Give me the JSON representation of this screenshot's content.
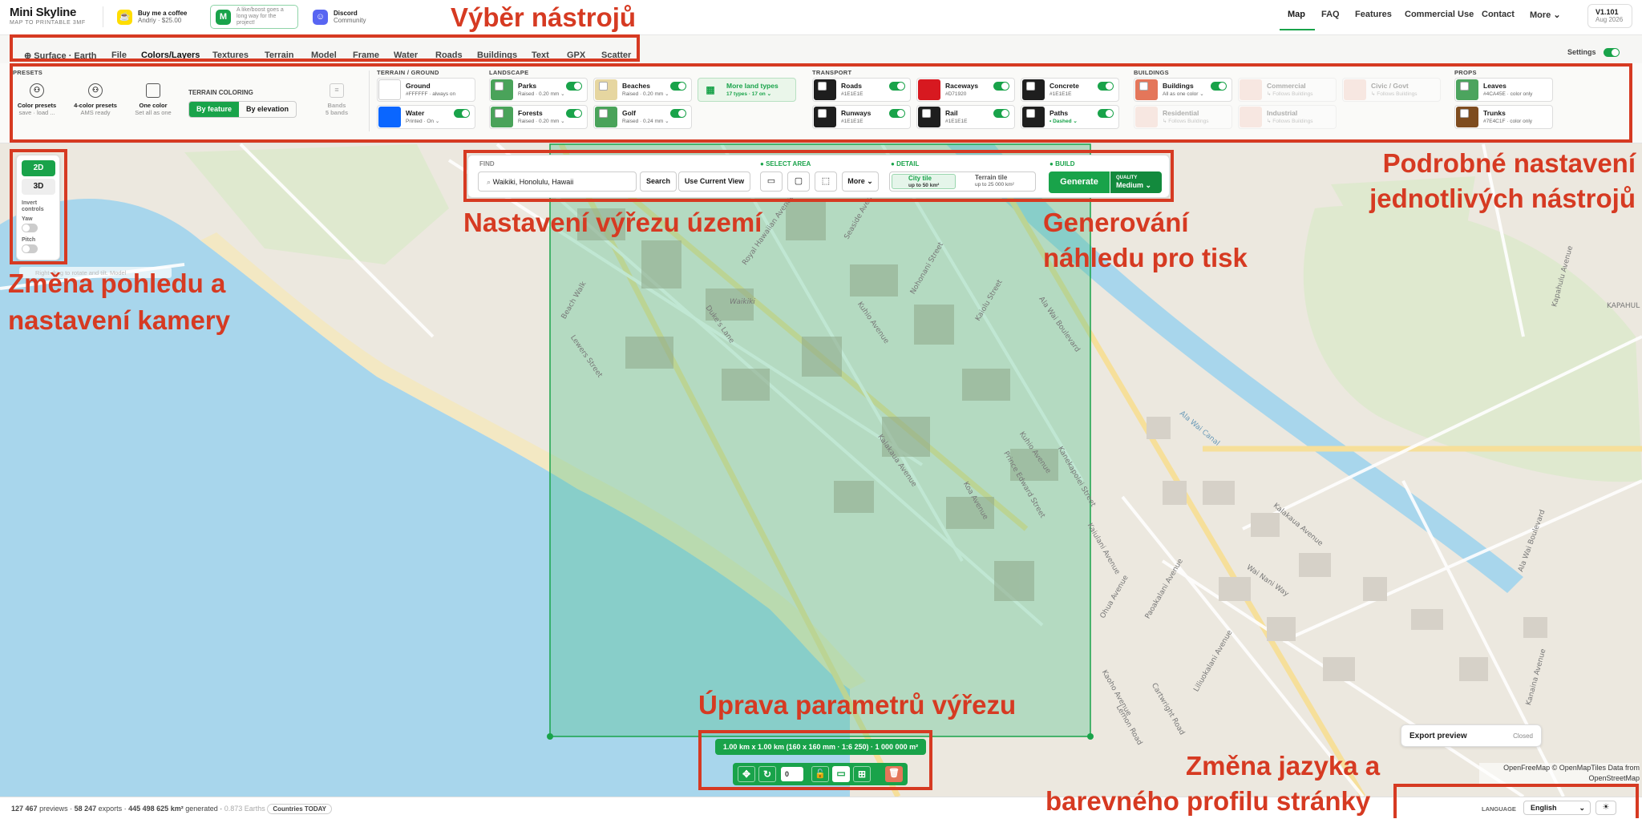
{
  "header": {
    "brand_title": "Mini Skyline",
    "brand_sub": "MAP TO PRINTABLE 3MF",
    "coffee": {
      "title": "Buy me a coffee",
      "sub": "Andriy · $25.00"
    },
    "like": {
      "line1": "A like/boost goes a",
      "line2": "long way for the",
      "line3": "project!"
    },
    "discord": {
      "title": "Discord",
      "sub": "Community"
    },
    "nav": [
      "Map",
      "FAQ",
      "Features",
      "Commercial Use",
      "Contact",
      "More"
    ],
    "version": "V1.101",
    "version_date": "Aug 2026"
  },
  "tabs": [
    "Surface · Earth",
    "File",
    "Colors/Layers",
    "Textures",
    "Terrain",
    "Model",
    "Frame",
    "Water",
    "Roads",
    "Buildings",
    "Text",
    "GPX",
    "Scatter"
  ],
  "settings_label": "Settings",
  "panel": {
    "presets_heading": "PRESETS",
    "presets": [
      {
        "title": "Color presets",
        "sub": "save · load ..."
      },
      {
        "title": "4-color presets",
        "sub": "AMS ready"
      },
      {
        "title": "One color",
        "sub": "Set all as one"
      }
    ],
    "terrain_coloring": "TERRAIN COLORING",
    "seg_by_feature": "By feature",
    "seg_by_elevation": "By elevation",
    "bands": "Bands",
    "bands_sub": "5 bands",
    "groups": [
      "TERRAIN / GROUND",
      "LANDSCAPE",
      "TRANSPORT",
      "BUILDINGS",
      "PROPS"
    ],
    "layers": [
      {
        "name": "Ground",
        "sub": "#FFFFFF · always on",
        "color": "#ffffff"
      },
      {
        "name": "Water",
        "sub": "Printed · On ⌄",
        "color": "#0a66ff"
      },
      {
        "name": "Parks",
        "sub": "Raised · 0.20 mm ⌄",
        "color": "#4aa35a"
      },
      {
        "name": "Forests",
        "sub": "Raised · 0.20 mm ⌄",
        "color": "#4aa35a"
      },
      {
        "name": "Beaches",
        "sub": "Raised · 0.20 mm ⌄",
        "color": "#e6d6a0"
      },
      {
        "name": "Golf",
        "sub": "Raised · 0.24 mm ⌄",
        "color": "#4aa35a"
      },
      {
        "name": "More land types",
        "sub": "17 types · 17 on ⌄",
        "color": "#eaf6ea"
      },
      {
        "name": "Roads",
        "sub": "#1E1E1E",
        "color": "#1e1e1e"
      },
      {
        "name": "Runways",
        "sub": "#1E1E1E",
        "color": "#1e1e1e"
      },
      {
        "name": "Raceways",
        "sub": "#D71920",
        "color": "#d71920"
      },
      {
        "name": "Rail",
        "sub": "#1E1E1E",
        "color": "#1e1e1e"
      },
      {
        "name": "Concrete",
        "sub": "#1E1E1E",
        "color": "#1e1e1e"
      },
      {
        "name": "Paths",
        "sub": "• Dashed ⌄",
        "color": "#1e1e1e"
      },
      {
        "name": "Buildings",
        "sub": "All as one color ⌄",
        "color": "#e4765a"
      },
      {
        "name": "Residential",
        "sub": "↳ Follows Buildings",
        "color": "#f2c4b8"
      },
      {
        "name": "Commercial",
        "sub": "↳ Follows Buildings",
        "color": "#f2c4b8"
      },
      {
        "name": "Industrial",
        "sub": "↳ Follows Buildings",
        "color": "#f2c4b8"
      },
      {
        "name": "Civic / Govt",
        "sub": "↳ Follows Buildings",
        "color": "#f2c4b8"
      },
      {
        "name": "Leaves",
        "sub": "#4CA45E · color only",
        "color": "#4ca45e"
      },
      {
        "name": "Trunks",
        "sub": "#7E4C1F · color only",
        "color": "#7e4c1f"
      }
    ]
  },
  "view": {
    "btn_2d": "2D",
    "btn_3d": "3D",
    "invert": "Invert controls",
    "yaw": "Yaw",
    "pitch": "Pitch",
    "hint": "Right-drag to rotate and tilt. Model"
  },
  "find": {
    "label": "FIND",
    "value": "Waikiki, Honolulu, Hawaii",
    "search": "Search",
    "current": "Use Current View",
    "select_area": "SELECT AREA",
    "more": "More ⌄",
    "detail": "DETAIL",
    "city_tile": "City tile",
    "city_sub": "up to 50 km²",
    "terrain_tile": "Terrain tile",
    "terrain_sub": "up to 25 000 km²",
    "build": "BUILD",
    "generate": "Generate",
    "quality_label": "QUALITY",
    "quality": "Medium"
  },
  "selection": {
    "info": "1.00 km x 1.00 km (160 x 160 mm · 1:6 250) · 1 000 000 m²",
    "rotation": "0"
  },
  "map_labels": [
    {
      "text": "Royal Hawaiian Avenue"
    },
    {
      "text": "Kuhio Avenue"
    },
    {
      "text": "Kalakaua Avenue"
    },
    {
      "text": "Ala Wai Boulevard"
    },
    {
      "text": "Ala Wai Canal"
    },
    {
      "text": "Kapahulu Avenue"
    },
    {
      "text": "Duke's Lane"
    },
    {
      "text": "Beach Walk"
    },
    {
      "text": "Lewers Street"
    },
    {
      "text": "Seaside Avenue"
    },
    {
      "text": "Nohonani Street"
    },
    {
      "text": "Kaiolu Street"
    },
    {
      "text": "Waikiki"
    },
    {
      "text": "Ohua Avenue"
    },
    {
      "text": "Paoakalani Avenue"
    },
    {
      "text": "Liliuokalani Avenue"
    },
    {
      "text": "Kuhio Avenue"
    },
    {
      "text": "Kanekapolei Street"
    },
    {
      "text": "Kaiulani Avenue"
    },
    {
      "text": "Prince Edward Street"
    },
    {
      "text": "Koa Avenue"
    },
    {
      "text": "Cartwright Road"
    },
    {
      "text": "Lemon Road"
    },
    {
      "text": "Kaoho Avenue"
    },
    {
      "text": "Wai Nani Way"
    },
    {
      "text": "Kalakaua Avenue"
    },
    {
      "text": "Ala Wai Boulevard"
    },
    {
      "text": "Kanaina Avenue"
    },
    {
      "text": "KAPAHUL"
    }
  ],
  "export": {
    "label": "Export preview",
    "state": "Closed"
  },
  "attribution": {
    "line1": "OpenFreeMap © OpenMapTiles Data from",
    "line2": "OpenStreetMap"
  },
  "footer": {
    "previews": "127 467",
    "previews_l": "previews",
    "exports": "58 247",
    "exports_l": "exports",
    "area": "445 498 625 km²",
    "area_l": "generated",
    "earths": "0.873 Earths",
    "countries": "Countries TODAY",
    "language_label": "LANGUAGE",
    "language": "English"
  },
  "annotations": {
    "tools": "Výběr nástrojů",
    "detail_1": "Podrobné nastavení",
    "detail_2": "jednotlivých nástrojů",
    "view_1": "Změna pohledu a",
    "view_2": "nastavení kamery",
    "area": "Nastavení výřezu území",
    "gen_1": "Generování",
    "gen_2": "náhledu pro tisk",
    "params": "Úprava parametrů výřezu",
    "lang_1": "Změna jazyka a",
    "lang_2": "barevného profilu stránky"
  },
  "colors": {
    "accent": "#19a34a",
    "annotation": "#d63a22",
    "water": "#a8d6ec",
    "land": "#ece8df",
    "selection": "#7fd1a7"
  }
}
